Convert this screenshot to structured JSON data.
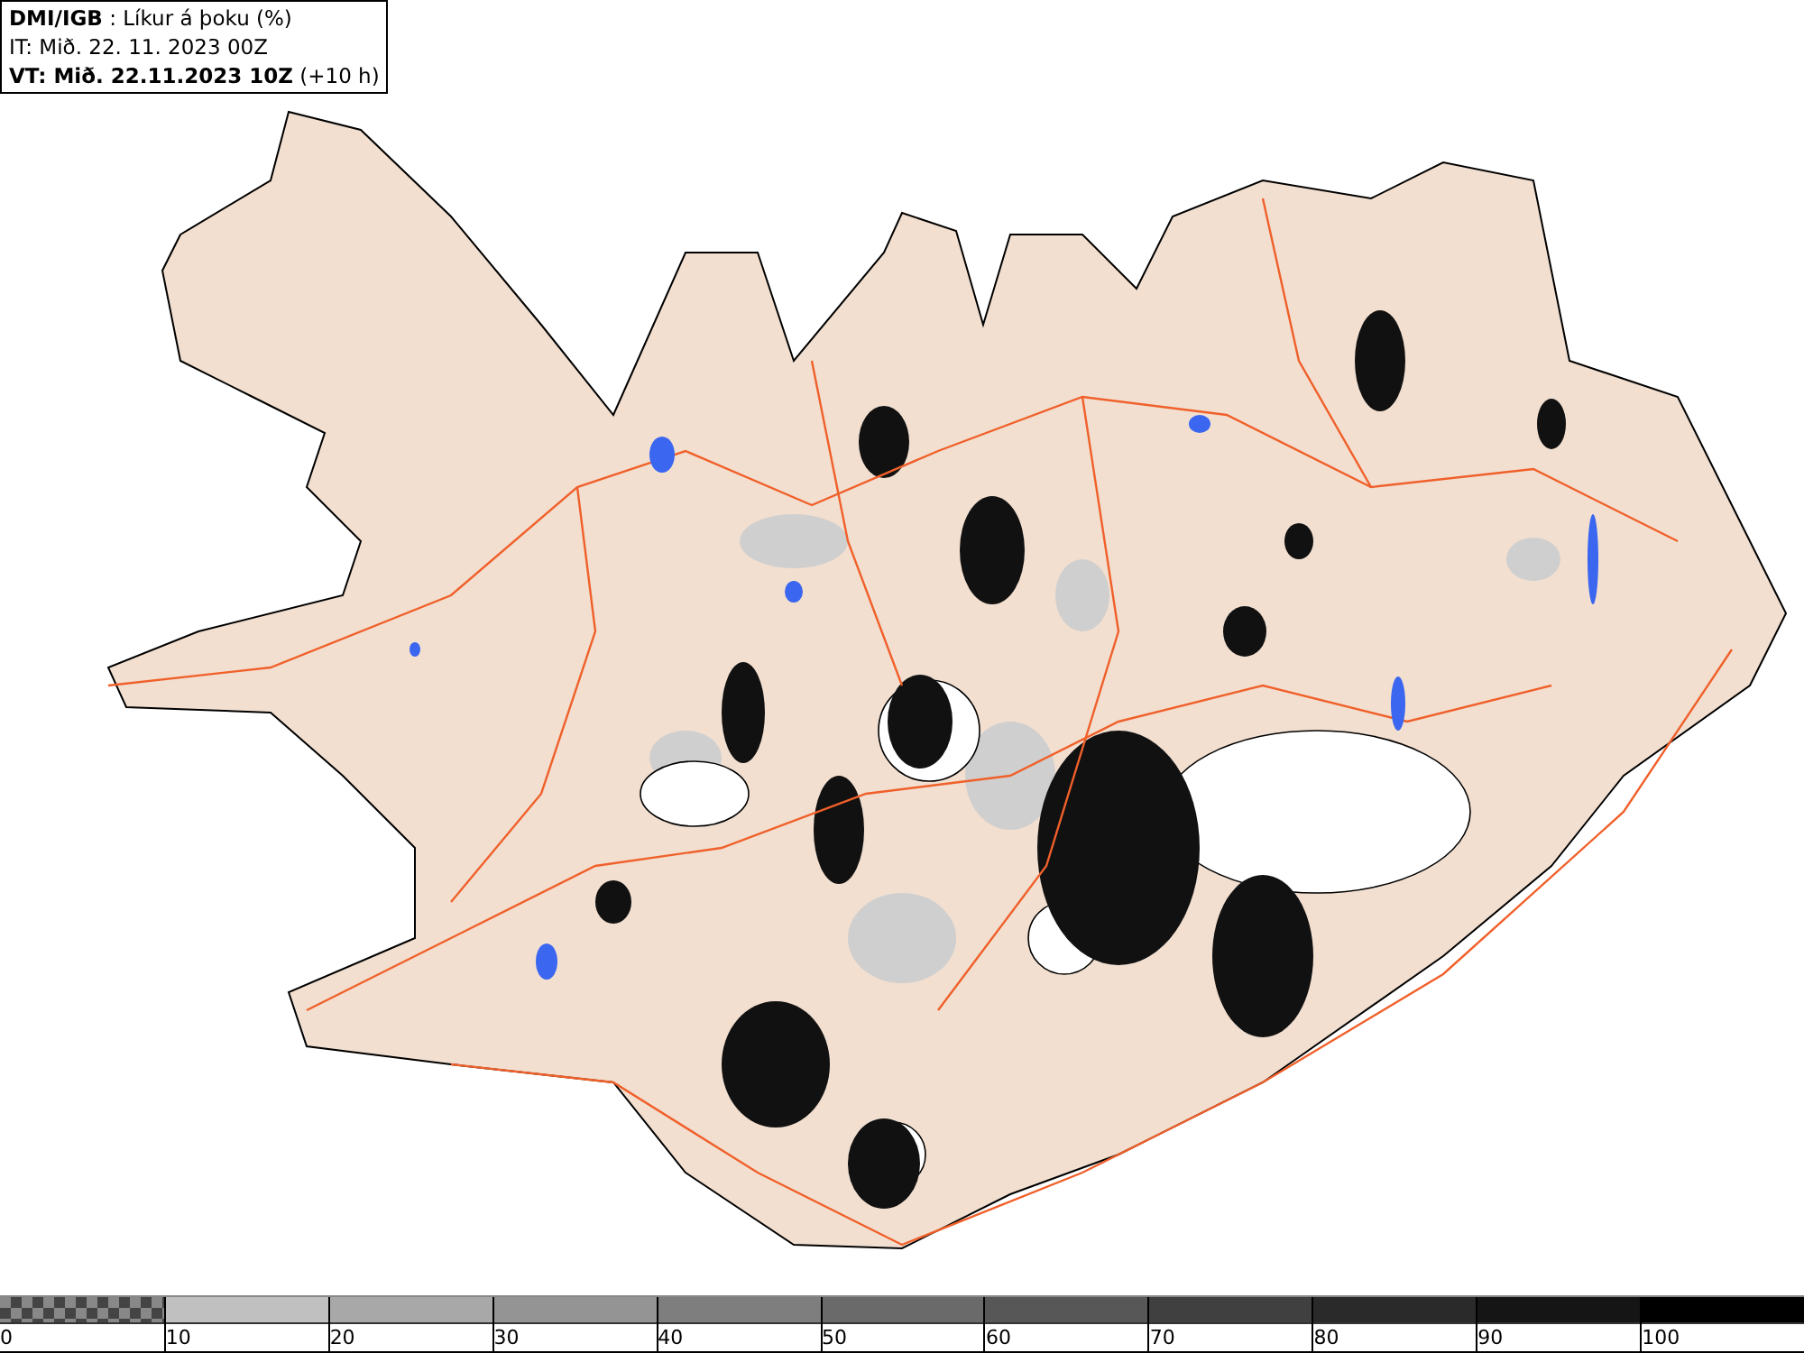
{
  "header": {
    "title": "**DMI/IGB** : Líkur á þoku (%)",
    "issue_time": "IT: Mið. 22. 11. 2023 00Z",
    "valid_time": "**VT: Mið. 22.11.2023 10Z** (+10 h)"
  },
  "legend": [
    {
      "label": "0",
      "kind": "checker"
    },
    {
      "label": "10",
      "kind": "solid",
      "color": "#c0c0c0"
    },
    {
      "label": "20",
      "kind": "solid",
      "color": "#a8a8a8"
    },
    {
      "label": "30",
      "kind": "solid",
      "color": "#949494"
    },
    {
      "label": "40",
      "kind": "solid",
      "color": "#7e7e7e"
    },
    {
      "label": "50",
      "kind": "solid",
      "color": "#6a6a6a"
    },
    {
      "label": "60",
      "kind": "solid",
      "color": "#575757"
    },
    {
      "label": "70",
      "kind": "solid",
      "color": "#404040"
    },
    {
      "label": "80",
      "kind": "solid",
      "color": "#2a2a2a"
    },
    {
      "label": "90",
      "kind": "solid",
      "color": "#151515"
    },
    {
      "label": "100",
      "kind": "solid",
      "color": "#000000"
    }
  ]
}
